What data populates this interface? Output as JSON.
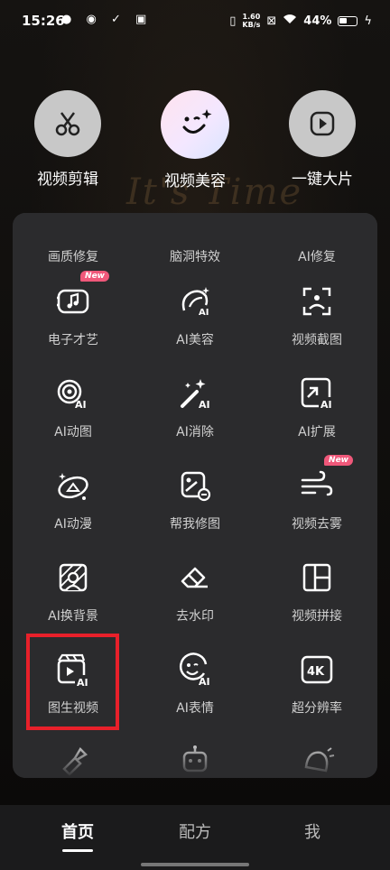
{
  "status_bar": {
    "time": "15:26",
    "net_speed_value": "1.60",
    "net_speed_unit": "KB/s",
    "battery": "44%"
  },
  "shortcuts": [
    {
      "label": "视频剪辑",
      "icon": "scissors-icon"
    },
    {
      "label": "视频美容",
      "icon": "face-sparkle-icon"
    },
    {
      "label": "一键大片",
      "icon": "play-icon"
    }
  ],
  "tools": [
    {
      "label": "画质修复",
      "icon": "quality-repair-icon"
    },
    {
      "label": "脑洞特效",
      "icon": "brain-effect-icon"
    },
    {
      "label": "AI修复",
      "icon": "ai-repair-icon"
    },
    {
      "label": "电子才艺",
      "icon": "music-screen-icon",
      "badge": "New"
    },
    {
      "label": "AI美容",
      "icon": "ai-beauty-icon"
    },
    {
      "label": "视频截图",
      "icon": "video-screenshot-icon"
    },
    {
      "label": "AI动图",
      "icon": "ai-gif-icon"
    },
    {
      "label": "AI消除",
      "icon": "ai-erase-icon"
    },
    {
      "label": "AI扩展",
      "icon": "ai-expand-icon"
    },
    {
      "label": "AI动漫",
      "icon": "ai-anime-icon"
    },
    {
      "label": "帮我修图",
      "icon": "photo-edit-icon"
    },
    {
      "label": "视频去雾",
      "icon": "dehaze-icon",
      "badge": "New"
    },
    {
      "label": "AI换背景",
      "icon": "ai-background-icon"
    },
    {
      "label": "去水印",
      "icon": "eraser-icon"
    },
    {
      "label": "视频拼接",
      "icon": "video-stitch-icon"
    },
    {
      "label": "图生视频",
      "icon": "image-to-video-icon"
    },
    {
      "label": "AI表情",
      "icon": "ai-emoji-icon"
    },
    {
      "label": "超分辨率",
      "icon": "4k-icon"
    },
    {
      "label": "",
      "icon": "lipstick-icon"
    },
    {
      "label": "",
      "icon": "robot-icon"
    },
    {
      "label": "",
      "icon": "bell-icon"
    }
  ],
  "bottom_nav": [
    {
      "label": "首页",
      "active": true
    },
    {
      "label": "配方",
      "active": false
    },
    {
      "label": "我",
      "active": false
    }
  ],
  "colors": {
    "highlight": "#e8202a",
    "badge": "#f0587a",
    "panel": "#2b2b2d"
  }
}
